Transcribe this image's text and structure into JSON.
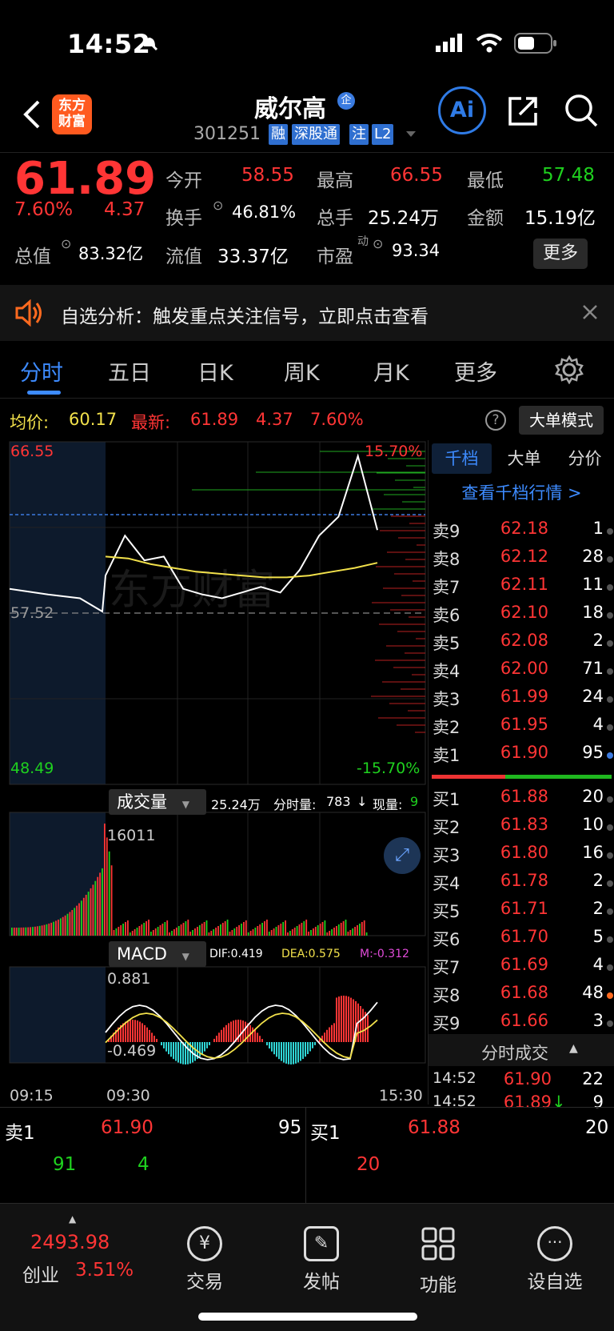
{
  "status_bar": {
    "time": "14:52"
  },
  "header": {
    "logo_text": "东方财富",
    "stock_name": "威尔高",
    "badge_qiye": "企",
    "stock_code": "301251",
    "tags": [
      "融",
      "深股通",
      "注",
      "L2"
    ],
    "ai_label": "Ai"
  },
  "quote": {
    "price": "61.89",
    "change_pct": "7.60%",
    "change": "4.37",
    "open_label": "今开",
    "open": "58.55",
    "high_label": "最高",
    "high": "66.55",
    "low_label": "最低",
    "low": "57.48",
    "turnover_label": "换手",
    "turnover": "46.81%",
    "total_hands_label": "总手",
    "total_hands": "25.24万",
    "amount_label": "金额",
    "amount": "15.19亿",
    "market_cap_label": "总值",
    "market_cap": "83.32亿",
    "float_cap_label": "流值",
    "float_cap": "33.37亿",
    "pe_label": "市盈",
    "pe_sup": "动",
    "pe": "93.34",
    "more_button": "更多"
  },
  "notice": {
    "text": "自选分析：触发重点关注信号，立即点击查看"
  },
  "tabs": [
    "分时",
    "五日",
    "日K",
    "周K",
    "月K",
    "更多"
  ],
  "info_row": {
    "avg_label": "均价:",
    "avg": "60.17",
    "latest_label": "最新:",
    "latest": "61.89",
    "latest_chg": "4.37",
    "latest_pct": "7.60%",
    "big_order_mode": "大单模式"
  },
  "chart": {
    "price_high": "66.55",
    "price_mid": "57.52",
    "price_low": "48.49",
    "pct_high": "15.70%",
    "pct_low": "-15.70%",
    "volume_selector": "成交量",
    "volume_total": "25.24万",
    "minute_vol_label": "分时量:",
    "minute_vol": "783",
    "current_vol_label": "现量:",
    "current_vol": "9",
    "volume_max": "16011",
    "macd_selector": "MACD",
    "dif": "DIF:0.419",
    "dea": "DEA:0.575",
    "m": "M:-0.312",
    "macd_high": "0.881",
    "macd_low": "-0.469",
    "time_start": "09:15",
    "time_open": "09:30",
    "time_end": "15:30",
    "watermark": "东方财富"
  },
  "chart_data": {
    "type": "line",
    "title": "",
    "xlabel": "",
    "ylabel": "",
    "x_ticks": [
      "09:15",
      "09:30",
      "15:30"
    ],
    "ylim": [
      48.49,
      66.55
    ],
    "reference_price": 57.52,
    "series": [
      {
        "values": [
          58.8,
          58.5,
          58.3,
          57.6,
          59.5,
          61.6,
          60.3,
          60.5,
          58.8,
          58.5,
          58.3,
          58.6,
          58.9,
          58.6,
          59.8,
          61.6,
          62.6,
          65.8,
          61.9
        ]
      },
      {
        "values": [
          60.5,
          60.4,
          60.1,
          59.9,
          59.7,
          59.6,
          59.5,
          59.4,
          59.4,
          59.5,
          59.7,
          59.9,
          60.17
        ]
      }
    ]
  },
  "book": {
    "tabs": [
      "千档",
      "大单",
      "分价"
    ],
    "view_link": "查看千档行情 >",
    "sells": [
      {
        "label": "卖9",
        "price": "62.18",
        "vol": "1"
      },
      {
        "label": "卖8",
        "price": "62.12",
        "vol": "28"
      },
      {
        "label": "卖7",
        "price": "62.11",
        "vol": "11"
      },
      {
        "label": "卖6",
        "price": "62.10",
        "vol": "18"
      },
      {
        "label": "卖5",
        "price": "62.08",
        "vol": "2"
      },
      {
        "label": "卖4",
        "price": "62.00",
        "vol": "71"
      },
      {
        "label": "卖3",
        "price": "61.99",
        "vol": "24"
      },
      {
        "label": "卖2",
        "price": "61.95",
        "vol": "4"
      },
      {
        "label": "卖1",
        "price": "61.90",
        "vol": "95"
      }
    ],
    "buys": [
      {
        "label": "买1",
        "price": "61.88",
        "vol": "20"
      },
      {
        "label": "买2",
        "price": "61.83",
        "vol": "10"
      },
      {
        "label": "买3",
        "price": "61.80",
        "vol": "16"
      },
      {
        "label": "买4",
        "price": "61.78",
        "vol": "2"
      },
      {
        "label": "买5",
        "price": "61.71",
        "vol": "2"
      },
      {
        "label": "买6",
        "price": "61.70",
        "vol": "5"
      },
      {
        "label": "买7",
        "price": "61.69",
        "vol": "4"
      },
      {
        "label": "买8",
        "price": "61.68",
        "vol": "48"
      },
      {
        "label": "买9",
        "price": "61.66",
        "vol": "3"
      }
    ],
    "ticks_title": "分时成交",
    "ticks": [
      {
        "time": "14:52",
        "price": "61.90",
        "vol": "22"
      },
      {
        "time": "14:52",
        "price": "61.89",
        "vol": "9"
      }
    ]
  },
  "lv1": {
    "sell1_label": "卖1",
    "sell1_price": "61.90",
    "sell1_vol": "95",
    "sell1_detail": [
      "91",
      "4"
    ],
    "buy1_label": "买1",
    "buy1_price": "61.88",
    "buy1_vol": "20",
    "buy1_detail": [
      "20"
    ]
  },
  "tabbar": {
    "index_value": "2493.98",
    "index_name": "创业",
    "index_pct": "3.51%",
    "items": [
      "交易",
      "发帖",
      "功能",
      "设自选"
    ]
  }
}
